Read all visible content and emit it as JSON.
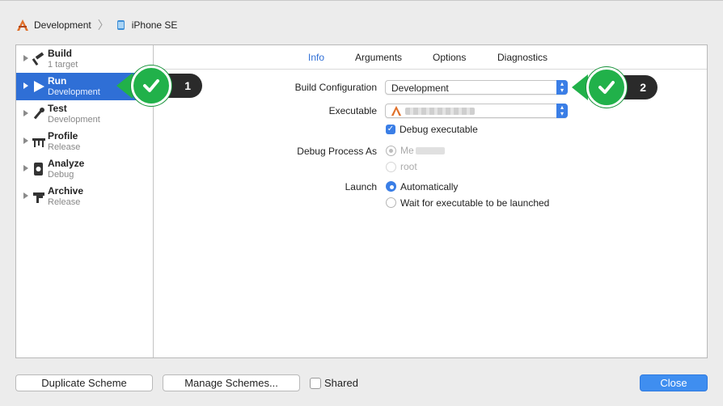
{
  "breadcrumb": {
    "scheme": "Development",
    "device": "iPhone SE"
  },
  "sidebar": {
    "items": [
      {
        "name": "Build",
        "sub": "1 target"
      },
      {
        "name": "Run",
        "sub": "Development"
      },
      {
        "name": "Test",
        "sub": "Development"
      },
      {
        "name": "Profile",
        "sub": "Release"
      },
      {
        "name": "Analyze",
        "sub": "Debug"
      },
      {
        "name": "Archive",
        "sub": "Release"
      }
    ],
    "selected": "Run"
  },
  "tabs": [
    {
      "label": "Info",
      "active": true
    },
    {
      "label": "Arguments",
      "active": false
    },
    {
      "label": "Options",
      "active": false
    },
    {
      "label": "Diagnostics",
      "active": false
    }
  ],
  "form": {
    "build_configuration_label": "Build Configuration",
    "build_configuration_value": "Development",
    "executable_label": "Executable",
    "debug_executable_label": "Debug executable",
    "debug_executable_checked": true,
    "debug_process_as_label": "Debug Process As",
    "debug_process_me": "Me",
    "debug_process_root": "root",
    "launch_label": "Launch",
    "launch_automatically": "Automatically",
    "launch_wait": "Wait for executable to be launched"
  },
  "callouts": {
    "first": "1",
    "second": "2"
  },
  "footer": {
    "duplicate": "Duplicate Scheme",
    "manage": "Manage Schemes...",
    "shared": "Shared",
    "close": "Close"
  },
  "colors": {
    "accent": "#2f6fd6",
    "callout_green": "#21b14a",
    "callout_dark": "#2a2a2a"
  }
}
